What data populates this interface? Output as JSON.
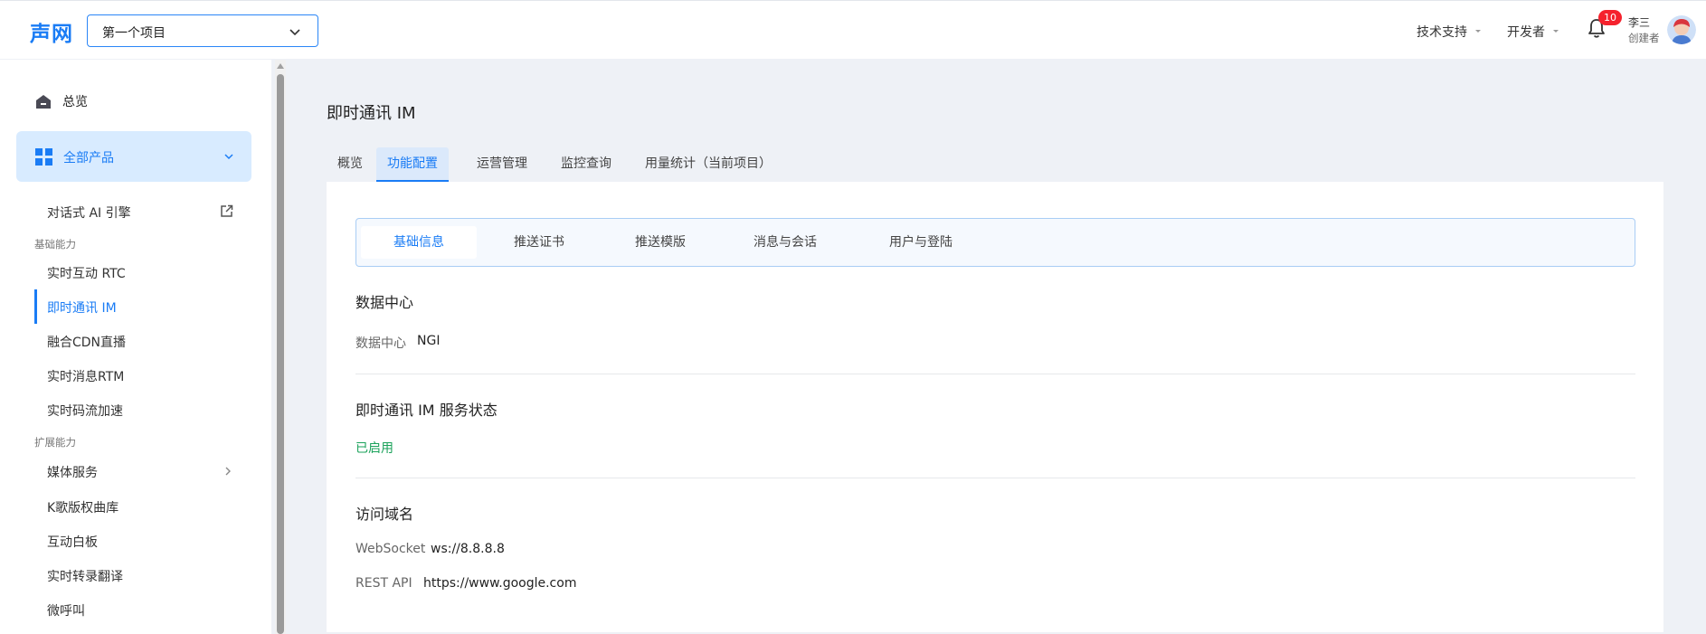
{
  "header": {
    "logo": "声网",
    "project": "第一个项目",
    "support": "技术支持",
    "developer": "开发者",
    "notification_count": "10",
    "user_name": "李三",
    "user_role": "创建者"
  },
  "sidebar": {
    "overview": "总览",
    "all_products": "全部产品",
    "ai_engine": "对话式 AI 引擎",
    "group_basic": "基础能力",
    "basic_items": [
      "实时互动 RTC",
      "即时通讯 IM",
      "融合CDN直播",
      "实时消息RTM",
      "实时码流加速"
    ],
    "group_ext": "扩展能力",
    "ext_items": [
      "媒体服务",
      "K歌版权曲库",
      "互动白板",
      "实时转录翻译",
      "微呼叫"
    ]
  },
  "main": {
    "title": "即时通讯 IM",
    "tabs": [
      "概览",
      "功能配置",
      "运营管理",
      "监控查询",
      "用量统计（当前项目）"
    ],
    "subtabs": [
      "基础信息",
      "推送证书",
      "推送模版",
      "消息与会话",
      "用户与登陆"
    ],
    "data_center": {
      "title": "数据中心",
      "label": "数据中心",
      "value": "NGI"
    },
    "service_status": {
      "title": "即时通讯 IM 服务状态",
      "value": "已启用"
    },
    "domains": {
      "title": "访问域名",
      "ws_label": "WebSocket",
      "ws_value": "ws://8.8.8.8",
      "rest_label": "REST API",
      "rest_value": "https://www.google.com"
    }
  },
  "colors": {
    "accent": "#1a7cf5",
    "status_enabled": "#1aa25a",
    "badge": "#f5222d"
  }
}
